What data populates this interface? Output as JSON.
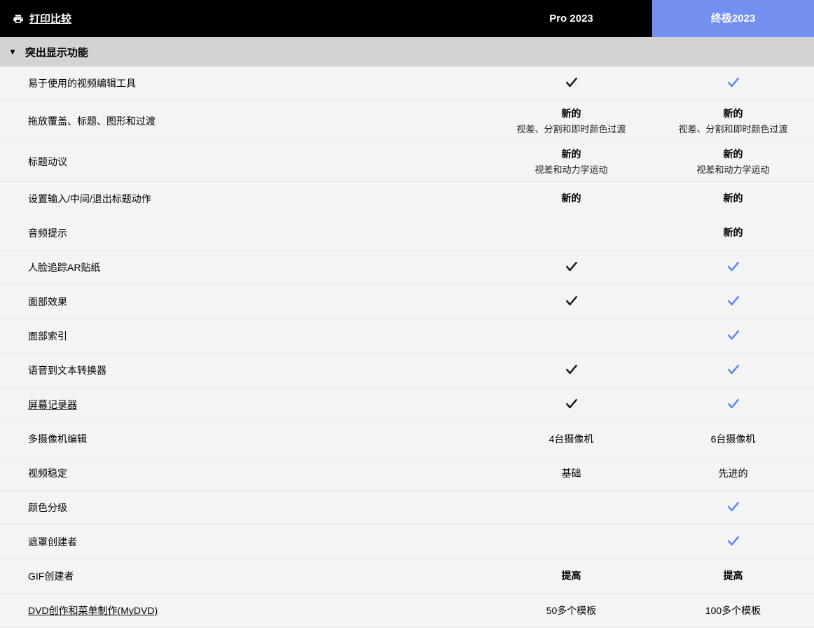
{
  "header": {
    "print_label": "打印比较",
    "col_pro": "Pro 2023",
    "col_ultimate": "终极2023"
  },
  "section": {
    "title": "突出显示功能"
  },
  "rows": [
    {
      "feature": "易于使用的视频编辑工具",
      "pro": {
        "type": "check"
      },
      "ult": {
        "type": "check"
      }
    },
    {
      "feature": "拖放覆盖、标题、图形和过渡",
      "pro": {
        "type": "text",
        "bold": "新的",
        "sub": "视差、分割和即时颜色过渡"
      },
      "ult": {
        "type": "text",
        "bold": "新的",
        "sub": "视差、分割和即时颜色过渡"
      }
    },
    {
      "feature": "标题动议",
      "pro": {
        "type": "text",
        "bold": "新的",
        "sub": "视差和动力学运动"
      },
      "ult": {
        "type": "text",
        "bold": "新的",
        "sub": "视差和动力学运动"
      }
    },
    {
      "feature": "设置输入/中间/退出标题动作",
      "pro": {
        "type": "text",
        "bold": "新的"
      },
      "ult": {
        "type": "text",
        "bold": "新的"
      }
    },
    {
      "feature": "音频提示",
      "pro": {
        "type": "empty"
      },
      "ult": {
        "type": "text",
        "bold": "新的"
      }
    },
    {
      "feature": "人脸追踪AR贴纸",
      "pro": {
        "type": "check"
      },
      "ult": {
        "type": "check"
      }
    },
    {
      "feature": "面部效果",
      "pro": {
        "type": "check"
      },
      "ult": {
        "type": "check"
      }
    },
    {
      "feature": "面部索引",
      "pro": {
        "type": "empty"
      },
      "ult": {
        "type": "check"
      }
    },
    {
      "feature": "语音到文本转换器",
      "pro": {
        "type": "check"
      },
      "ult": {
        "type": "check"
      }
    },
    {
      "feature": "屏幕记录器",
      "link": true,
      "pro": {
        "type": "check"
      },
      "ult": {
        "type": "check"
      }
    },
    {
      "feature": "多摄像机编辑",
      "pro": {
        "type": "plain",
        "text": "4台摄像机"
      },
      "ult": {
        "type": "plain",
        "text": "6台摄像机"
      }
    },
    {
      "feature": "视频稳定",
      "pro": {
        "type": "plain",
        "text": "基础"
      },
      "ult": {
        "type": "plain",
        "text": "先进的"
      }
    },
    {
      "feature": "颜色分级",
      "pro": {
        "type": "empty"
      },
      "ult": {
        "type": "check"
      }
    },
    {
      "feature": "遮罩创建者",
      "pro": {
        "type": "empty"
      },
      "ult": {
        "type": "check"
      }
    },
    {
      "feature": "GIF创建者",
      "pro": {
        "type": "text",
        "bold": "提高"
      },
      "ult": {
        "type": "text",
        "bold": "提高"
      }
    },
    {
      "feature": "DVD创作和菜单制作(MyDVD)",
      "link": true,
      "pro": {
        "type": "plain",
        "text": "50多个模板"
      },
      "ult": {
        "type": "plain",
        "text": "100多个模板"
      }
    }
  ]
}
